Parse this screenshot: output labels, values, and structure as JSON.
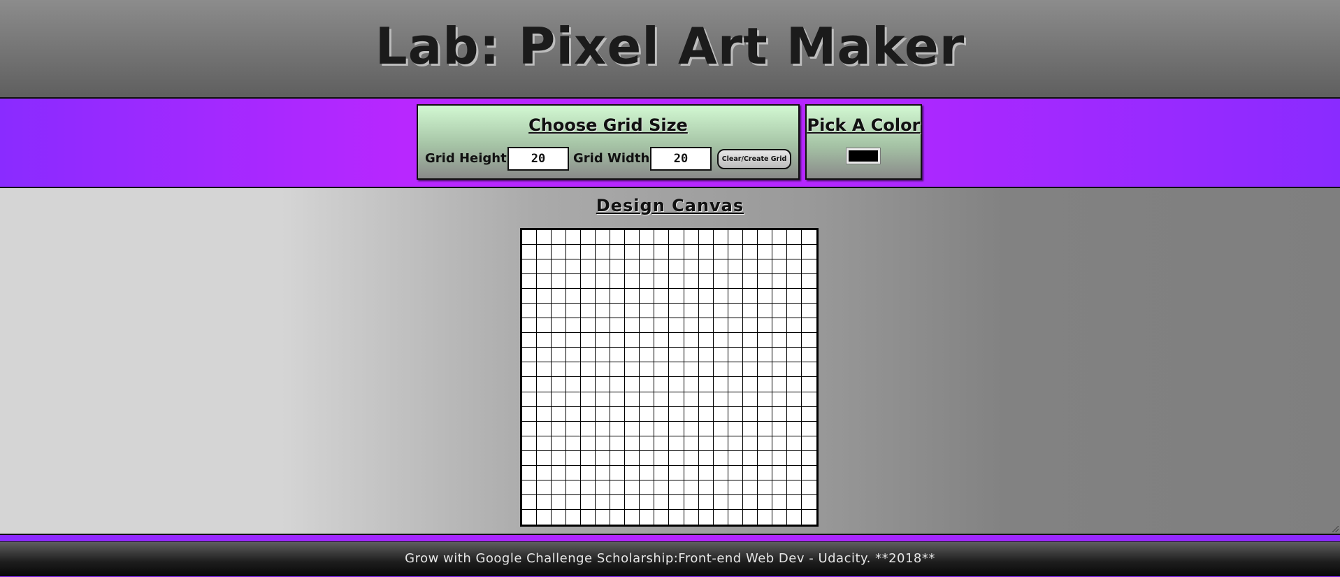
{
  "header": {
    "title": "Lab: Pixel Art Maker"
  },
  "grid_size_panel": {
    "heading": "Choose Grid Size",
    "height_label": "Grid Height:",
    "height_value": "20",
    "width_label": "Grid Width:",
    "width_value": "20",
    "button_label": "Clear/Create Grid"
  },
  "color_panel": {
    "heading": "Pick A Color",
    "selected_color": "#000000"
  },
  "canvas": {
    "heading": "Design Canvas",
    "rows": 20,
    "columns": 20,
    "cell_color": "#ffffff"
  },
  "footer": {
    "text": "Grow with Google Challenge Scholarship:Front-end Web Dev - Udacity. **2018**"
  },
  "colors": {
    "accent_purple": "#b527ff",
    "panel_green": "#d2f8d2"
  }
}
